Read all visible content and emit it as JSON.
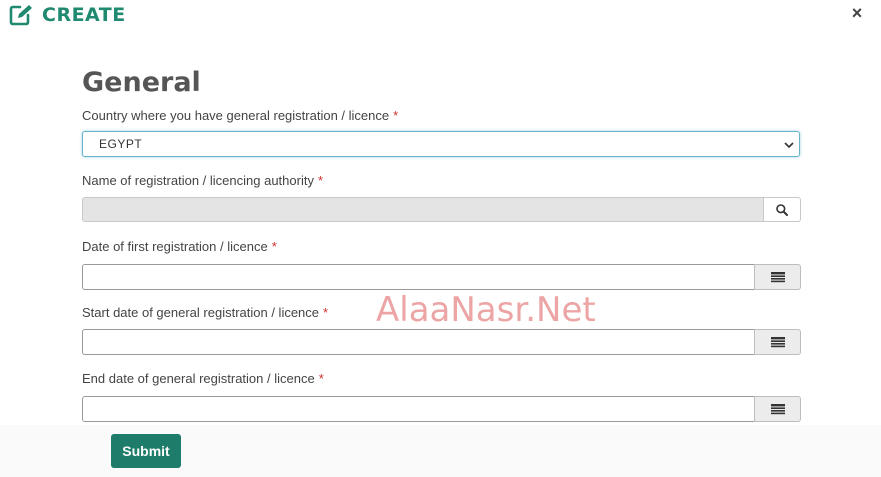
{
  "header": {
    "logo_text": "CREATE",
    "close_label": "×"
  },
  "form": {
    "title": "General",
    "required_marker": "*",
    "country": {
      "label": "Country where you have general registration / licence",
      "value": "EGYPT"
    },
    "authority": {
      "label": "Name of registration / licencing authority"
    },
    "first_date": {
      "label": "Date of first registration / licence"
    },
    "start_date": {
      "label": "Start date of general registration / licence"
    },
    "end_date": {
      "label": "End date of general registration / licence"
    },
    "submit_label": "Submit"
  },
  "watermark": "AlaaNasr.Net",
  "colors": {
    "brand": "#1f8a70",
    "submit_bg": "#1e7d6a",
    "required": "#c9302c",
    "focus_border": "#66b3c9"
  }
}
